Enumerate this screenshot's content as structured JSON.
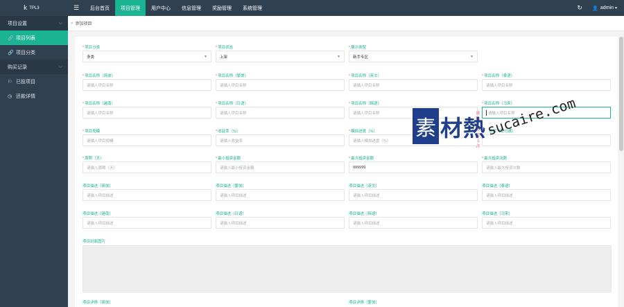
{
  "brand": {
    "logo": "k",
    "title": "TPL3"
  },
  "topnav": [
    {
      "label": "后台首页"
    },
    {
      "label": "项目管理"
    },
    {
      "label": "用户中心"
    },
    {
      "label": "信息管理"
    },
    {
      "label": "奖励管理"
    },
    {
      "label": "系统管理"
    }
  ],
  "user": {
    "name": "admin"
  },
  "icons": {
    "menu": "menu-icon",
    "refresh": "refresh-icon",
    "user": "user-icon"
  },
  "colors": {
    "accent": "#1ab394",
    "dark": "#2f4050",
    "error": "#ed5565"
  },
  "sidebar": {
    "group1": "项目设置",
    "item1": "项目列表",
    "item2": "项目分类",
    "group2": "购买记录",
    "item3": "已投项目",
    "item4": "还款详情"
  },
  "breadcrumb": "添加项目",
  "form": {
    "category": {
      "label": "项目分类",
      "value": "多类"
    },
    "status": {
      "label": "项目状态",
      "value": "上架"
    },
    "display": {
      "label": "展示类型",
      "value": "新手专区"
    },
    "name_zh_cn": {
      "label": "项目名称（简体）",
      "placeholder": "请输入项目名称"
    },
    "name_zh_tw": {
      "label": "项目名称（繁体）",
      "placeholder": "请输入项目名称"
    },
    "name_en": {
      "label": "项目名称（英文）",
      "placeholder": "请输入项目名称"
    },
    "name_ko": {
      "label": "项目名称（泰语）",
      "placeholder": "请输入项目名称"
    },
    "name_th": {
      "label": "项目名称（越南）",
      "placeholder": "请输入项目名称"
    },
    "name_ja": {
      "label": "项目名称（日语）",
      "placeholder": "请输入项目名称"
    },
    "name_vi": {
      "label": "项目名称（韩语）",
      "placeholder": "请输入项目名称"
    },
    "name_ms": {
      "label": "项目名称（马来）",
      "placeholder": "请输入项目名称",
      "error": "请输入项目名称"
    },
    "scale": {
      "label": "项目规模",
      "placeholder": "请输入项目规模"
    },
    "yield": {
      "label": "收益率（%）",
      "placeholder": "请输入收益率"
    },
    "progress": {
      "label": "模拟进度（%）",
      "placeholder": "请输入模拟进度（%）"
    },
    "guarantee": {
      "label": "担保（财付通）"
    },
    "period": {
      "label": "周期（天）",
      "placeholder": "请输入周期（天）"
    },
    "min_invest": {
      "label": "最小投资金额",
      "placeholder": "请输入最小投资金额"
    },
    "max_invest": {
      "label": "最大投资金额",
      "value": "999999"
    },
    "max_times": {
      "label": "最大投资次数",
      "placeholder": "请输入最大投资次数"
    },
    "desc_zh_cn": {
      "label": "项目描述（简体）",
      "placeholder": "请输入项目描述"
    },
    "desc_zh_tw": {
      "label": "项目描述（繁体）",
      "placeholder": "请输入项目描述"
    },
    "desc_en": {
      "label": "项目描述（英文）",
      "placeholder": "请输入项目描述"
    },
    "desc_ko": {
      "label": "项目描述（泰语）",
      "placeholder": "请输入项目描述"
    },
    "desc_th": {
      "label": "项目描述（越南）",
      "placeholder": "请输入项目描述"
    },
    "desc_ja": {
      "label": "项目描述（日语）",
      "placeholder": "请输入项目描述"
    },
    "desc_vi": {
      "label": "项目描述（韩语）",
      "placeholder": "请输入项目描述"
    },
    "desc_ms": {
      "label": "项目描述（马来）",
      "placeholder": "请输入项目描述"
    },
    "cover": {
      "label": "项目封面图片"
    },
    "detail_cn": {
      "label": "项目详情（简体）"
    },
    "detail_tw": {
      "label": "项目详情（繁体）"
    }
  },
  "watermark": {
    "glyph": "素",
    "word": "材熱",
    "url": "sucaire.com"
  }
}
